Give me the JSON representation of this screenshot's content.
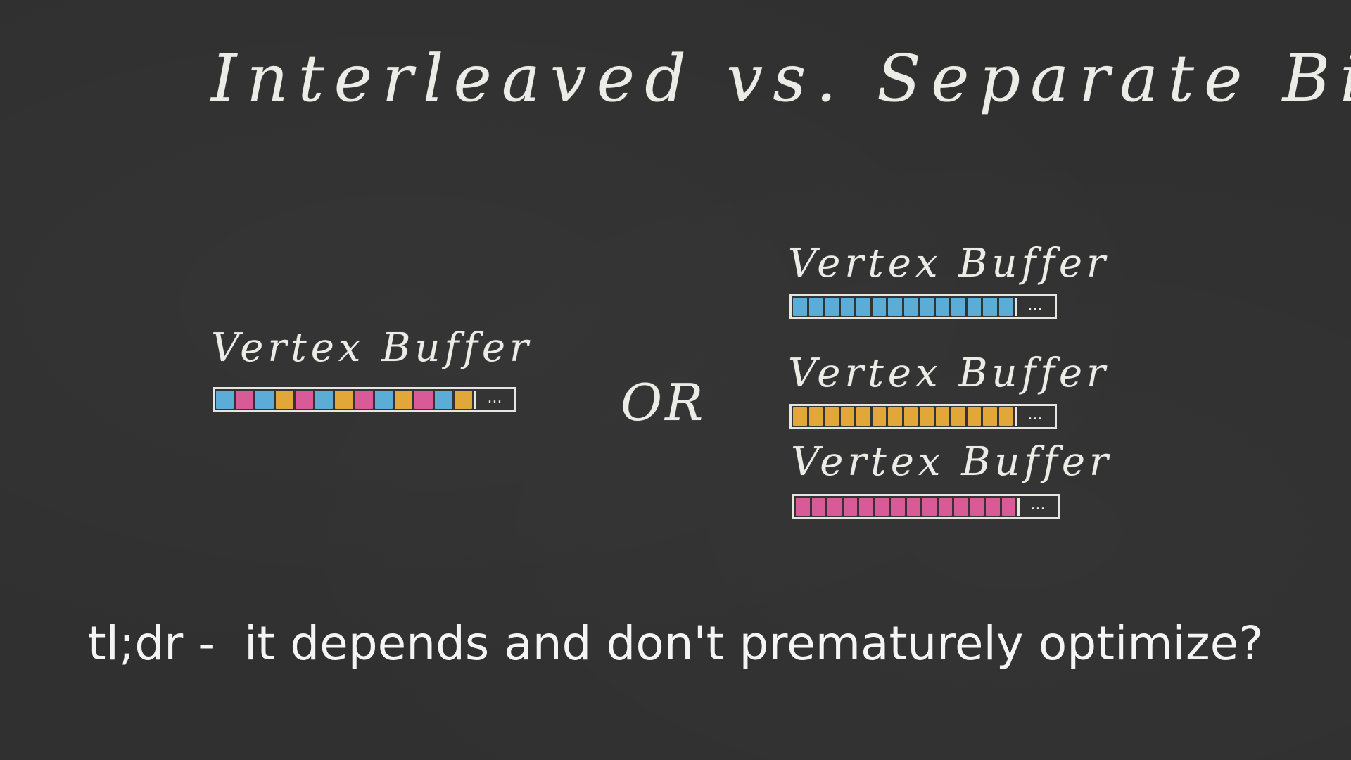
{
  "title": "Interleaved vs. Separate Bindings ?",
  "interleaved": {
    "label": "Vertex Buffer",
    "cells": [
      "blue",
      "pink",
      "blue",
      "yellow",
      "pink",
      "blue",
      "yellow",
      "pink",
      "blue",
      "yellow",
      "pink",
      "blue",
      "yellow"
    ],
    "ellipsis": "..."
  },
  "or_label": "OR",
  "separate": [
    {
      "label": "Vertex Buffer",
      "color": "blue",
      "cells": 14,
      "ellipsis": "..."
    },
    {
      "label": "Vertex Buffer",
      "color": "yellow",
      "cells": 14,
      "ellipsis": "..."
    },
    {
      "label": "Vertex Buffer",
      "color": "pink",
      "cells": 14,
      "ellipsis": "..."
    }
  ],
  "colors": {
    "blue": "#5fb6e6",
    "yellow": "#f0b23a",
    "pink": "#e65ea0"
  },
  "tldr": "tl;dr -  it depends and don't prematurely optimize?"
}
